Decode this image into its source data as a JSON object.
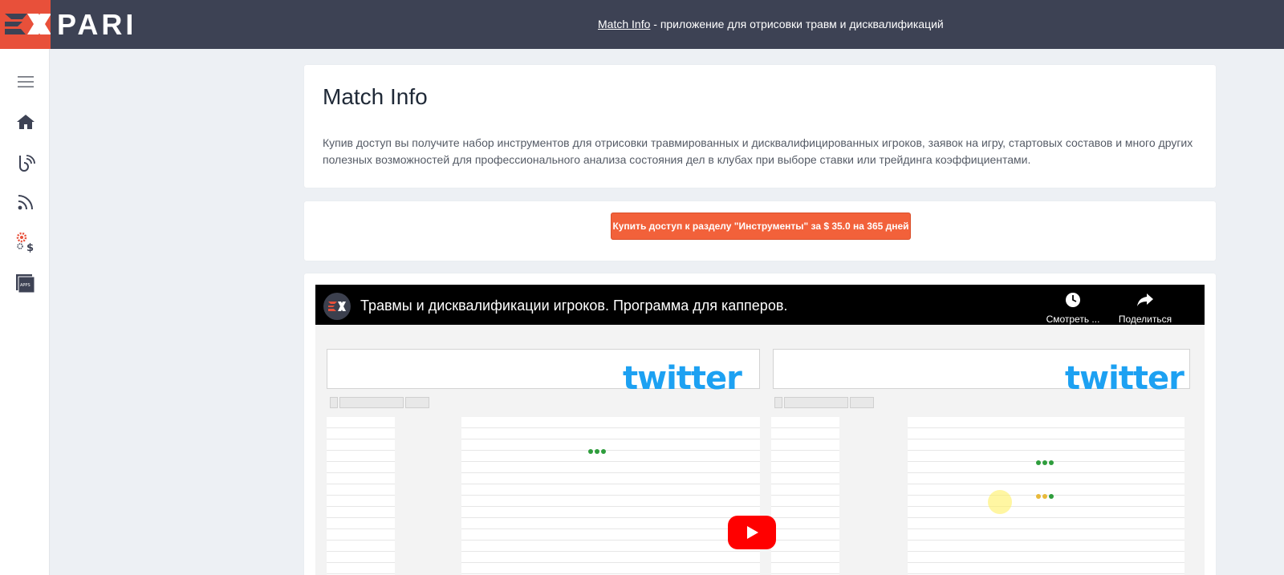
{
  "header": {
    "logo_text": "PARI",
    "link_text": "Match Info",
    "tagline": " - приложение для отрисовки травм и дисквалификаций"
  },
  "sidebar": {
    "icons": [
      "menu-icon",
      "home-icon",
      "broadcast-b-icon",
      "rss-icon",
      "money-gear-icon",
      "apps-icon"
    ],
    "apps_label": "APPS"
  },
  "main": {
    "title": "Match Info",
    "description": "Купив доступ вы получите набор инструментов для отрисовки травмированных и дисквалифицированных игроков, заявок на игру, стартовых составов и много других полезных возможностей для профессионального анализа состояния дел в клубах при выборе ставки или трейдинга коэффициентами.",
    "buy_button": "Купить доступ к разделу \"Инструменты\" за $ 35.0 на 365 дней"
  },
  "video": {
    "title": "Травмы и дисквалификации игроков. Программа для капперов.",
    "watch_later": "Смотреть ...",
    "share": "Поделиться",
    "twitter_word": "twitter"
  },
  "colors": {
    "topbar": "#3d4254",
    "brand": "#e8503a",
    "button": "#f2613a",
    "youtube_red": "#ff0000"
  }
}
